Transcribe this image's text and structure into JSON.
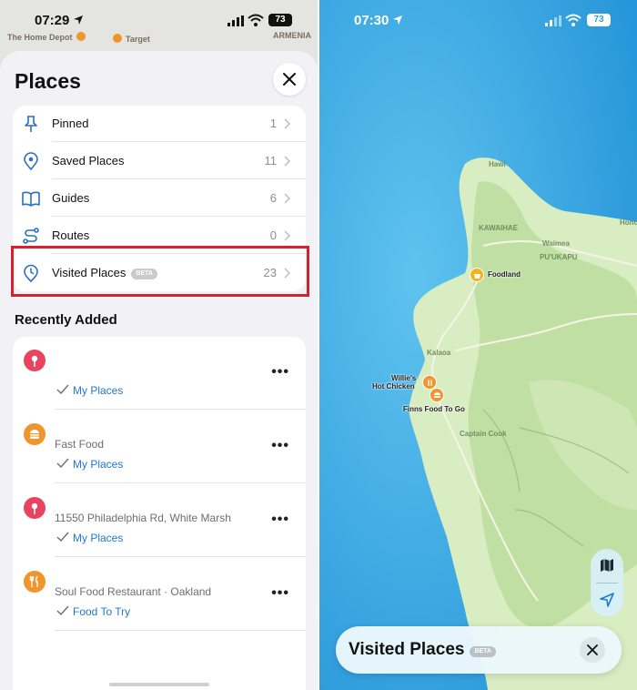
{
  "left": {
    "status": {
      "time": "07:29",
      "battery": "73"
    },
    "map_labels": [
      "The Home Depot",
      "Target",
      "ARMENIA"
    ],
    "sheet": {
      "title": "Places",
      "rows": [
        {
          "icon": "pin-icon",
          "label": "Pinned",
          "count": "1"
        },
        {
          "icon": "location-marker-icon",
          "label": "Saved Places",
          "count": "11"
        },
        {
          "icon": "book-icon",
          "label": "Guides",
          "count": "6"
        },
        {
          "icon": "route-icon",
          "label": "Routes",
          "count": "0"
        },
        {
          "icon": "clock-pin-icon",
          "label": "Visited Places",
          "badge": "BETA",
          "count": "23"
        }
      ],
      "section_title": "Recently Added",
      "recent": [
        {
          "icon": "pin-icon",
          "color": "#e8445f",
          "subtitle": "",
          "collection": "My Places"
        },
        {
          "icon": "burger-icon",
          "color": "#f0952b",
          "subtitle": "Fast Food",
          "collection": "My Places"
        },
        {
          "icon": "pin-icon",
          "color": "#e8445f",
          "subtitle": "11550 Philadelphia Rd, White Marsh",
          "collection": "My Places"
        },
        {
          "icon": "fork-knife-icon",
          "color": "#f0952b",
          "subtitle": "Soul Food Restaurant · Oakland",
          "collection": "Food To Try"
        }
      ],
      "more_label": "•••"
    }
  },
  "right": {
    "status": {
      "time": "07:30",
      "battery": "73"
    },
    "map_labels": {
      "hawi": "Hawi",
      "kawaihae": "KAWAIHAE",
      "waimea": "Waimea",
      "puukapu": "PU'UKAPU",
      "kalaoa": "Kalaoa",
      "captain_cook": "Captain Cook",
      "honokaa": "Honoka'a"
    },
    "pois": [
      {
        "name": "Foodland",
        "icon": "basket-icon",
        "color": "#f2b31d"
      },
      {
        "name": "Willie's Hot Chicken",
        "line1": "Willie's",
        "line2": "Hot Chicken",
        "icon": "fork-knife-icon",
        "color": "#f0952b"
      },
      {
        "name": "Finns Food To Go",
        "icon": "burger-icon",
        "color": "#f0952b"
      }
    ],
    "bottom_sheet": {
      "title": "Visited Places",
      "badge": "BETA"
    }
  },
  "colors": {
    "accent": "#1f77d6",
    "highlight_box": "#d4232b",
    "ocean": "#2fa1e0",
    "land": "#d9edc2"
  }
}
